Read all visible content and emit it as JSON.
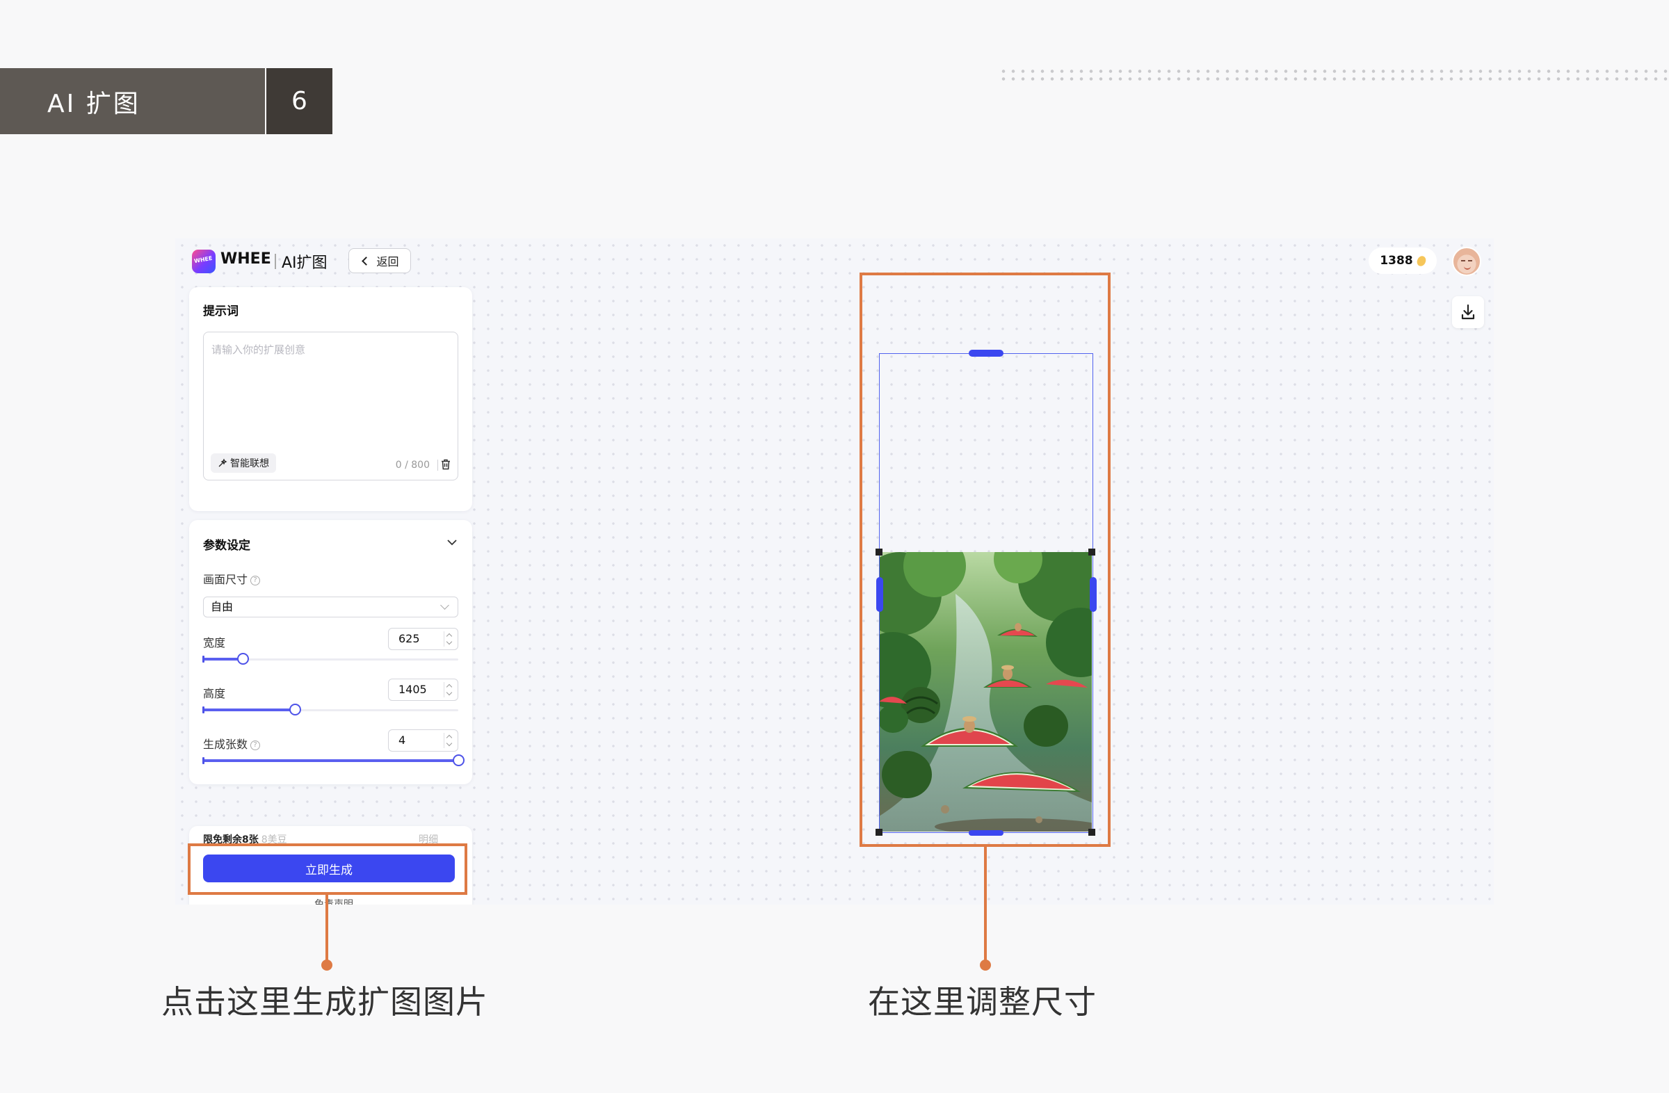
{
  "slide": {
    "title": "AI 扩图",
    "page_number": "6"
  },
  "app": {
    "brand": "WHEE",
    "logo_text": "WHEE",
    "module": "AI扩图",
    "back_label": "返回",
    "credits": "1388"
  },
  "prompt": {
    "title": "提示词",
    "placeholder": "请输入你的扩展创意",
    "assist_label": "智能联想",
    "counter": "0 / 800"
  },
  "params": {
    "title": "参数设定",
    "size_label": "画面尺寸",
    "size_value": "自由",
    "width_label": "宽度",
    "width_value": "625",
    "width_fraction": 0.155,
    "height_label": "高度",
    "height_value": "1405",
    "height_fraction": 0.36,
    "count_label": "生成张数",
    "count_value": "4",
    "count_fraction": 1.0
  },
  "generate": {
    "quota_label": "限免剩余8张",
    "quota_sub": "8美豆",
    "detail_label": "明细",
    "button_label": "立即生成",
    "disclaimer": "免责声明"
  },
  "annotations": {
    "left_caption": "点击这里生成扩图图片",
    "right_caption": "在这里调整尺寸",
    "accent_color": "#de7a44"
  },
  "theme": {
    "primary": "#3b47f0",
    "header_bg": "#5e5954",
    "header_num_bg": "#3f3a36"
  }
}
